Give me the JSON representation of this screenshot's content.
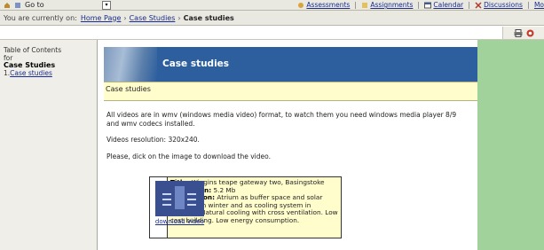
{
  "topbar": {
    "goto_label": "Go to",
    "nav": [
      {
        "label": "Assessments"
      },
      {
        "label": "Assignments"
      },
      {
        "label": "Calendar"
      },
      {
        "label": "Discussions"
      },
      {
        "label": "Mo"
      }
    ]
  },
  "breadcrumb": {
    "prefix": "You are currently on:",
    "items": [
      "Home Page",
      "Case Studies"
    ],
    "current": "Case studies"
  },
  "sidebar": {
    "toc_line1": "Table of Contents",
    "toc_line2": "for",
    "toc_title": "Case Studies",
    "item_number": "1.",
    "item_label": "Case studies"
  },
  "banner": {
    "title": "Case studies"
  },
  "section": {
    "heading": "Case studies"
  },
  "body": {
    "p1": "All videos are in wmv (windows media video) format, to watch them you need windows media player 8/9 and wmv codecs installed.",
    "p2": "Videos resolution: 320x240.",
    "p3": "Please, dick on the image to download the video."
  },
  "video": {
    "download_label": "download video",
    "title_label": "Title:",
    "title_value": "Wiggins teape gateway two, Basingstoke",
    "dimension_label": "Dimension:",
    "dimension_value": "5.2 Mb",
    "description_label": "Description:",
    "description_value": "Atrium as buffer space and solar collector in winter and as cooling system in summer. Natural cooling with cross ventilation. Low cost building. Low energy consumption."
  },
  "colors": {
    "banner": "#2d5e9e",
    "highlight": "#fffdcc",
    "right_panel": "#a1d29c",
    "link": "#1a2c8f"
  }
}
